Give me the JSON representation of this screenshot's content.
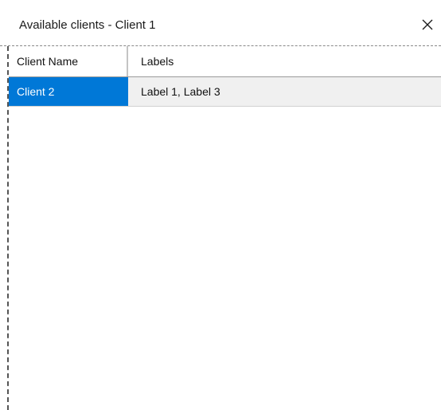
{
  "window": {
    "title": "Available clients - Client 1",
    "close_icon": "close-icon"
  },
  "table": {
    "columns": [
      "Client Name",
      "Labels"
    ],
    "rows": [
      {
        "client_name": "Client 2",
        "labels": "Label 1, Label 3",
        "selected": true
      }
    ]
  },
  "colors": {
    "selection": "#0078d7",
    "row_background": "#f0f0f0"
  }
}
